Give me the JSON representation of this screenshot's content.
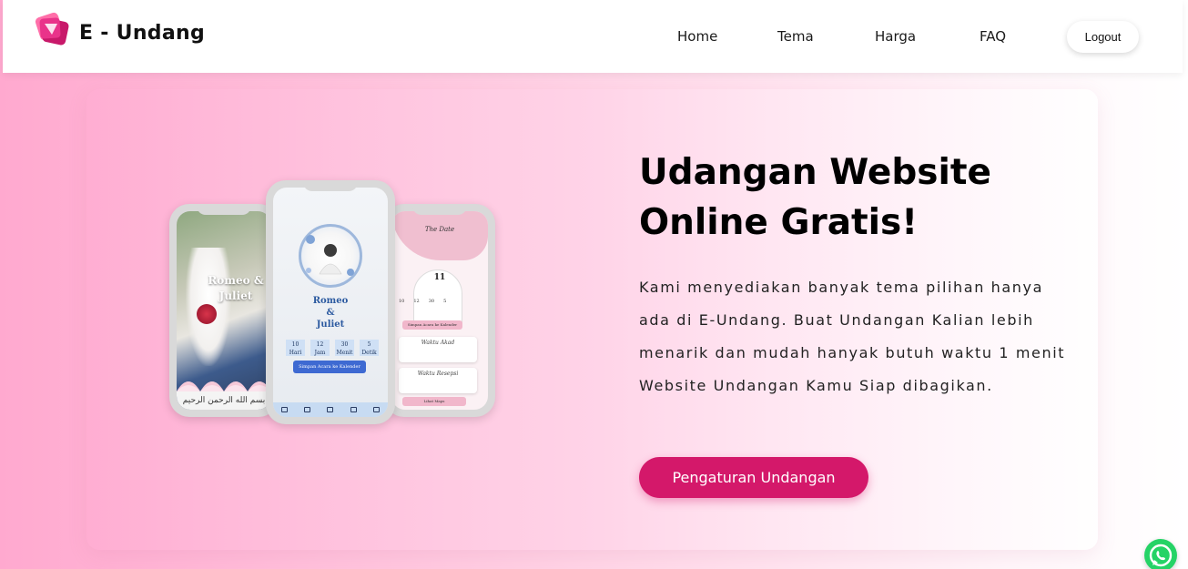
{
  "brand": {
    "name": "E - Undang",
    "logo_icon": "stacked-cards-logo-icon",
    "logo_colors": [
      "#e9338a",
      "#c8196a",
      "#ff6fa9"
    ]
  },
  "nav": {
    "links": [
      "Home",
      "Tema",
      "Harga",
      "FAQ"
    ],
    "logout_label": "Logout"
  },
  "hero": {
    "title": "Udangan Website Online Gratis!",
    "description": "Kami menyediakan banyak tema pilihan hanya ada di E-Undang. Buat Undangan Kalian lebih menarik dan mudah hanyak butuh waktu 1 menit Website Undangan Kamu Siap dibagikan.",
    "cta_label": "Pengaturan Undangan",
    "cta_color": "#d4186a"
  },
  "mockups": {
    "left": {
      "names": "Romeo & Juliet",
      "footer": "بسم الله الرحمن الرحيم"
    },
    "middle": {
      "names_line1": "Romeo",
      "names_line2": "&",
      "names_line3": "Juliet",
      "countdown": [
        {
          "value": "10",
          "unit": "Hari"
        },
        {
          "value": "12",
          "unit": "Jam"
        },
        {
          "value": "30",
          "unit": "Menit"
        },
        {
          "value": "5",
          "unit": "Detik"
        }
      ],
      "button": "Simpan Acara ke Kalender"
    },
    "right": {
      "heading": "The Date",
      "day": "11",
      "countdown": [
        "10",
        "12",
        "30",
        "5"
      ],
      "pill": "Simpan Acara ke Kalender",
      "card1": "Waktu Akad",
      "card2": "Waktu Resepsi",
      "map_pill": "Lihat Maps"
    }
  },
  "floating": {
    "whatsapp_icon": "whatsapp-icon"
  }
}
